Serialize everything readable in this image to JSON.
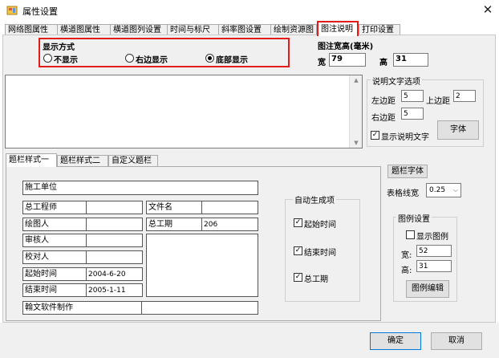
{
  "window": {
    "title": "属性设置",
    "close": "✕"
  },
  "tabs": [
    {
      "label": "网络图属性"
    },
    {
      "label": "横道图属性"
    },
    {
      "label": "横道图列设置"
    },
    {
      "label": "时间与标尺"
    },
    {
      "label": "斜率图设置"
    },
    {
      "label": "绘制资源图"
    },
    {
      "label": "图注说明"
    },
    {
      "label": "打印设置"
    }
  ],
  "display_mode": {
    "title": "显示方式",
    "options": [
      {
        "label": "不显示",
        "selected": false
      },
      {
        "label": "右边显示",
        "selected": false
      },
      {
        "label": "底部显示",
        "selected": true
      }
    ]
  },
  "legend_size": {
    "title": "图注宽高(毫米)",
    "width_label": "宽",
    "width_value": "79",
    "height_label": "高",
    "height_value": "31"
  },
  "desc_options": {
    "title": "说明文字选项",
    "left_margin_label": "左边距",
    "left_margin_value": "5",
    "top_margin_label": "上边距",
    "top_margin_value": "2",
    "right_margin_label": "右边距",
    "right_margin_value": "5",
    "show_desc_label": "显示说明文字",
    "show_desc_checked": true,
    "font_button": "字体"
  },
  "subtabs": [
    {
      "label": "题栏样式一"
    },
    {
      "label": "题栏样式二"
    },
    {
      "label": "自定义题栏"
    }
  ],
  "title_block": {
    "unit": "施工单位",
    "chief_engineer": "总工程师",
    "file_name": "文件名",
    "drawer": "绘图人",
    "total_duration": "总工期",
    "total_duration_value": "206",
    "reviewer": "审核人",
    "checker": "校对人",
    "start_time": "起始时间",
    "start_time_value": "2004-6-20",
    "end_time": "结束时间",
    "end_time_value": "2005-1-11",
    "credit": "翰文软件制作"
  },
  "auto_generate": {
    "title": "自动生成项",
    "items": [
      {
        "label": "起始时间",
        "checked": true
      },
      {
        "label": "结束时间",
        "checked": true
      },
      {
        "label": "总工期",
        "checked": true
      }
    ]
  },
  "title_font_button": "题栏字体",
  "line_width": {
    "label": "表格线宽",
    "value": "0.25"
  },
  "legend_settings": {
    "title": "图例设置",
    "show_label": "显示图例",
    "show_checked": false,
    "width_label": "宽:",
    "width_value": "52",
    "height_label": "高:",
    "height_value": "31",
    "edit_button": "图例编辑"
  },
  "buttons": {
    "ok": "确定",
    "cancel": "取消"
  },
  "colors": {
    "highlight": "#e21b1b",
    "accent": "#0078d7"
  }
}
